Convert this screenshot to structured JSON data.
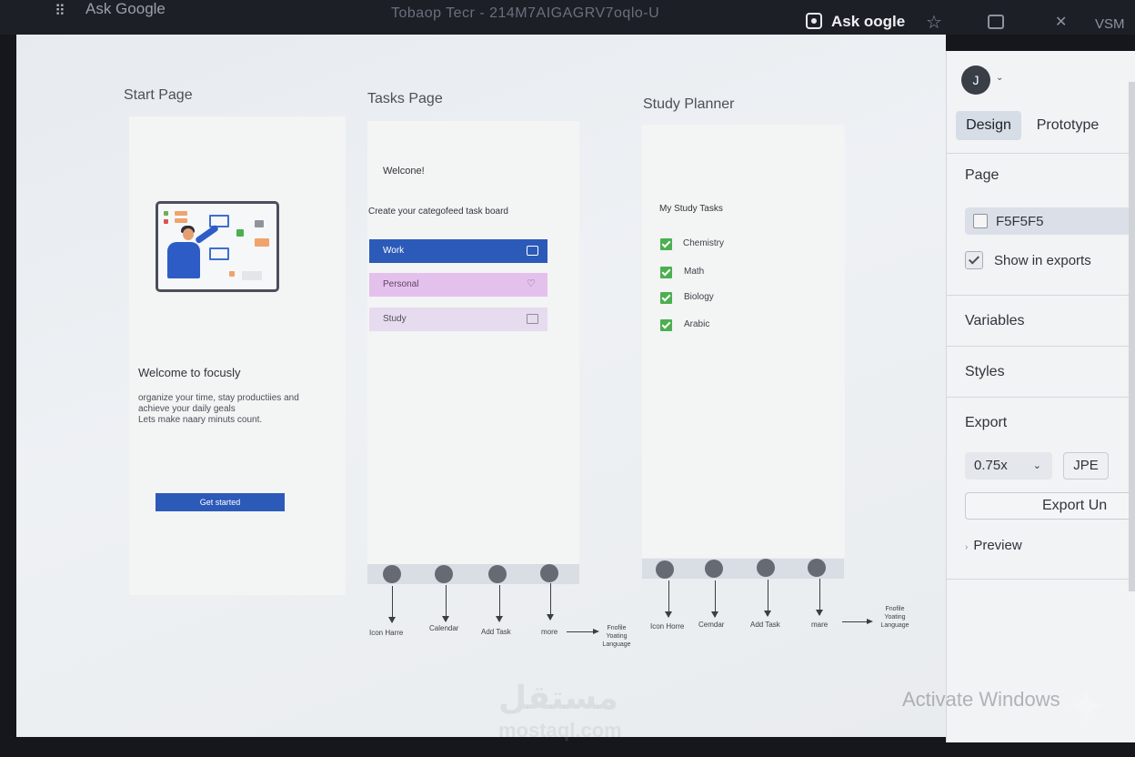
{
  "browser": {
    "search_label": "Ask Google",
    "doc_title": "Tobaop  Tecr - 214M7AIGAGRV7oqlo-U",
    "ask_button": "Ask oogle",
    "right_text": "VSM"
  },
  "frames": {
    "start": {
      "title": "Start Page",
      "welcome_heading": "Welcome to focusly",
      "body_lines": [
        "organize your time, stay productiies and",
        "achieve your daily geals",
        "Lets make naary minuts count."
      ],
      "button": "Get started"
    },
    "tasks": {
      "title": "Tasks Page",
      "welcome": "Welcone!",
      "subtitle": "Create your categofeed task board",
      "rows": [
        "Work",
        "Personal",
        "Study"
      ]
    },
    "study": {
      "title": "Study Planner",
      "heading": "My Study Tasks",
      "items": [
        "Chemistry",
        "Math",
        "Biology",
        "Arabic"
      ]
    }
  },
  "nav_left": {
    "labels": [
      "Icon Harre",
      "Calendar",
      "Add Task",
      "more"
    ],
    "profile_note": [
      "Fnofile",
      "Yoating",
      "Language"
    ]
  },
  "nav_right": {
    "labels": [
      "Icon Horre",
      "Cemdar",
      "Add Task",
      "mare"
    ],
    "profile_note": [
      "Fnofile",
      "Yoating",
      "Language"
    ]
  },
  "panel": {
    "avatar_initial": "J",
    "tabs": [
      "Design",
      "Prototype"
    ],
    "page_label": "Page",
    "page_color": "F5F5F5",
    "show_in_exports": "Show in exports",
    "variables": "Variables",
    "styles": "Styles",
    "export_label": "Export",
    "scale": "0.75x",
    "format": "JPE",
    "export_button": "Export Un",
    "preview": "Preview"
  },
  "overlay": {
    "activate": "Activate Windows",
    "watermark_ar": "مستقل",
    "watermark_en": "mostaql.com"
  },
  "colors": {
    "primary_blue": "#2c5ab8",
    "personal_pink": "#e3c1ec",
    "study_lavender": "#e6dbef",
    "check_green": "#4caf50"
  }
}
